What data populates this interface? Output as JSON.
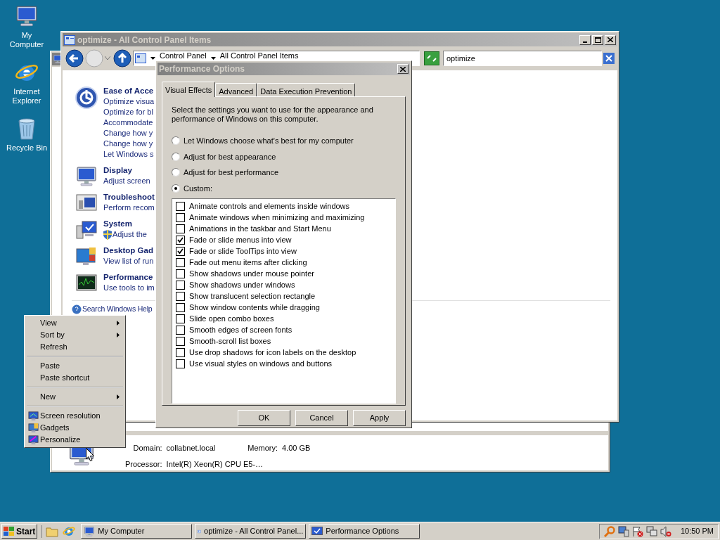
{
  "desktop_icons": [
    {
      "kind": "computer",
      "label": "My Computer"
    },
    {
      "kind": "browser",
      "label": "Internet Explorer"
    },
    {
      "kind": "trash",
      "label": "Recycle Bin"
    }
  ],
  "system_window": {
    "fields": [
      {
        "label": "Domain:",
        "value": "collabnet.local"
      },
      {
        "label": "Memory:",
        "value": "4.00 GB"
      },
      {
        "label": "Processor:",
        "value": "Intel(R) Xeon(R) CPU E5-…"
      }
    ]
  },
  "control_panel": {
    "title": "optimize - All Control Panel Items",
    "breadcrumbs": [
      "Control Panel",
      "All Control Panel Items"
    ],
    "search": {
      "value": "optimize"
    },
    "items": [
      {
        "kind": "accessibility",
        "title": "Ease of Acce",
        "links": [
          "Optimize visua",
          "Optimize for bl",
          "Accommodate",
          "Change how y",
          "Change how y",
          "Let Windows s"
        ]
      },
      {
        "kind": "display",
        "title": "Display",
        "links": [
          "Adjust screen"
        ]
      },
      {
        "kind": "troubleshoot",
        "title": "Troubleshoot",
        "links": [
          "Perform recom"
        ]
      },
      {
        "kind": "system",
        "title": "System",
        "links": [
          "Adjust the"
        ]
      },
      {
        "kind": "gadgets",
        "title": "Desktop Gad",
        "links": [
          "View list of run"
        ]
      },
      {
        "kind": "performance",
        "title": "Performance",
        "links": [
          "Use tools to im"
        ]
      }
    ],
    "help_link": "Search Windows Help"
  },
  "dialog": {
    "title": "Performance Options",
    "tabs": [
      {
        "label": "Visual Effects",
        "selected": true
      },
      {
        "label": "Advanced",
        "selected": false
      },
      {
        "label": "Data Execution Prevention",
        "selected": false
      }
    ],
    "intro": "Select the settings you want to use for the appearance and performance of Windows on this computer.",
    "radios": [
      {
        "label": "Let Windows choose what's best for my computer",
        "selected": false
      },
      {
        "label": "Adjust for best appearance",
        "selected": false
      },
      {
        "label": "Adjust for best performance",
        "selected": false
      },
      {
        "label": "Custom:",
        "selected": true
      }
    ],
    "effects": [
      {
        "label": "Animate controls and elements inside windows",
        "checked": false
      },
      {
        "label": "Animate windows when minimizing and maximizing",
        "checked": false
      },
      {
        "label": "Animations in the taskbar and Start Menu",
        "checked": false
      },
      {
        "label": "Fade or slide menus into view",
        "checked": true
      },
      {
        "label": "Fade or slide ToolTips into view",
        "checked": true
      },
      {
        "label": "Fade out menu items after clicking",
        "checked": false
      },
      {
        "label": "Show shadows under mouse pointer",
        "checked": false
      },
      {
        "label": "Show shadows under windows",
        "checked": false
      },
      {
        "label": "Show translucent selection rectangle",
        "checked": false
      },
      {
        "label": "Show window contents while dragging",
        "checked": false
      },
      {
        "label": "Slide open combo boxes",
        "checked": false
      },
      {
        "label": "Smooth edges of screen fonts",
        "checked": false
      },
      {
        "label": "Smooth-scroll list boxes",
        "checked": false
      },
      {
        "label": "Use drop shadows for icon labels on the desktop",
        "checked": false
      },
      {
        "label": "Use visual styles on windows and buttons",
        "checked": false
      }
    ],
    "buttons": [
      "OK",
      "Cancel",
      "Apply"
    ]
  },
  "context_menu": [
    {
      "kind": "item",
      "label": "View",
      "submenu": true
    },
    {
      "kind": "item",
      "label": "Sort by",
      "submenu": true
    },
    {
      "kind": "item",
      "label": "Refresh",
      "submenu": false
    },
    {
      "kind": "separator"
    },
    {
      "kind": "item",
      "label": "Paste",
      "submenu": false
    },
    {
      "kind": "item",
      "label": "Paste shortcut",
      "submenu": false
    },
    {
      "kind": "separator"
    },
    {
      "kind": "item",
      "label": "New",
      "submenu": true
    },
    {
      "kind": "separator"
    },
    {
      "kind": "icon_item",
      "label": "Screen resolution",
      "submenu": false
    },
    {
      "kind": "icon_item",
      "label": "Gadgets",
      "submenu": false
    },
    {
      "kind": "icon_item",
      "label": "Personalize",
      "submenu": false
    }
  ],
  "taskbar": {
    "start": "Start",
    "tasks": [
      {
        "kind": "computer",
        "label": "My Computer"
      },
      {
        "kind": "control_panel",
        "label": "optimize - All Control Panel..."
      },
      {
        "kind": "options",
        "label": "Performance Options"
      }
    ],
    "clock": "10:50 PM"
  }
}
